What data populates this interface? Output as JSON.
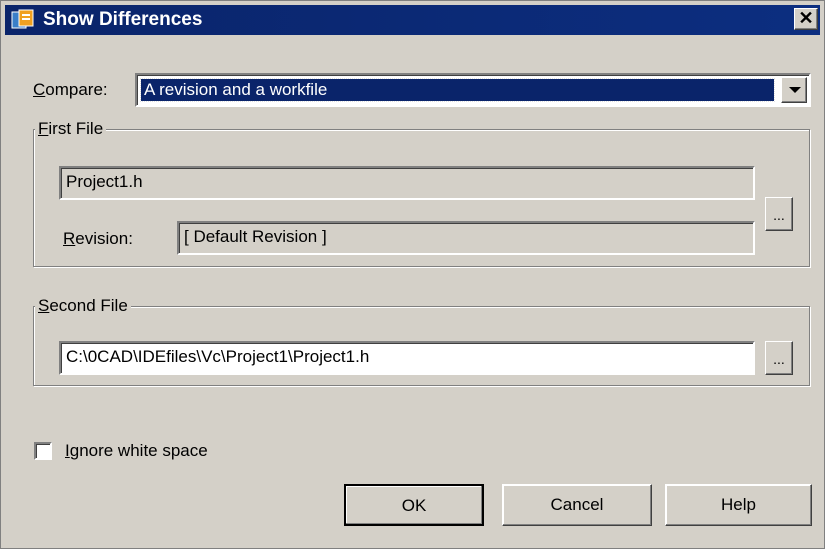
{
  "window": {
    "title": "Show Differences",
    "close_label": "✕"
  },
  "compare": {
    "label_accel": "C",
    "label_rest": "ompare:",
    "selected": "A revision and a workfile"
  },
  "first_file": {
    "legend_accel": "F",
    "legend_rest": "irst File",
    "filename": "Project1.h",
    "revision_label_accel": "R",
    "revision_label_rest": "evision:",
    "revision_value": "[ Default Revision ]",
    "browse_label": "..."
  },
  "second_file": {
    "legend_accel": "S",
    "legend_rest": "econd File",
    "path": "C:\\0CAD\\IDEfiles\\Vc\\Project1\\Project1.h",
    "browse_label": "..."
  },
  "options": {
    "ignore_ws_accel": "I",
    "ignore_ws_rest": "gnore white space",
    "ignore_ws_checked": false
  },
  "buttons": {
    "ok": "OK",
    "cancel": "Cancel",
    "help": "Help"
  },
  "colors": {
    "titlebar": "#0a246a",
    "face": "#d4d0c8",
    "selection": "#0a246a"
  }
}
